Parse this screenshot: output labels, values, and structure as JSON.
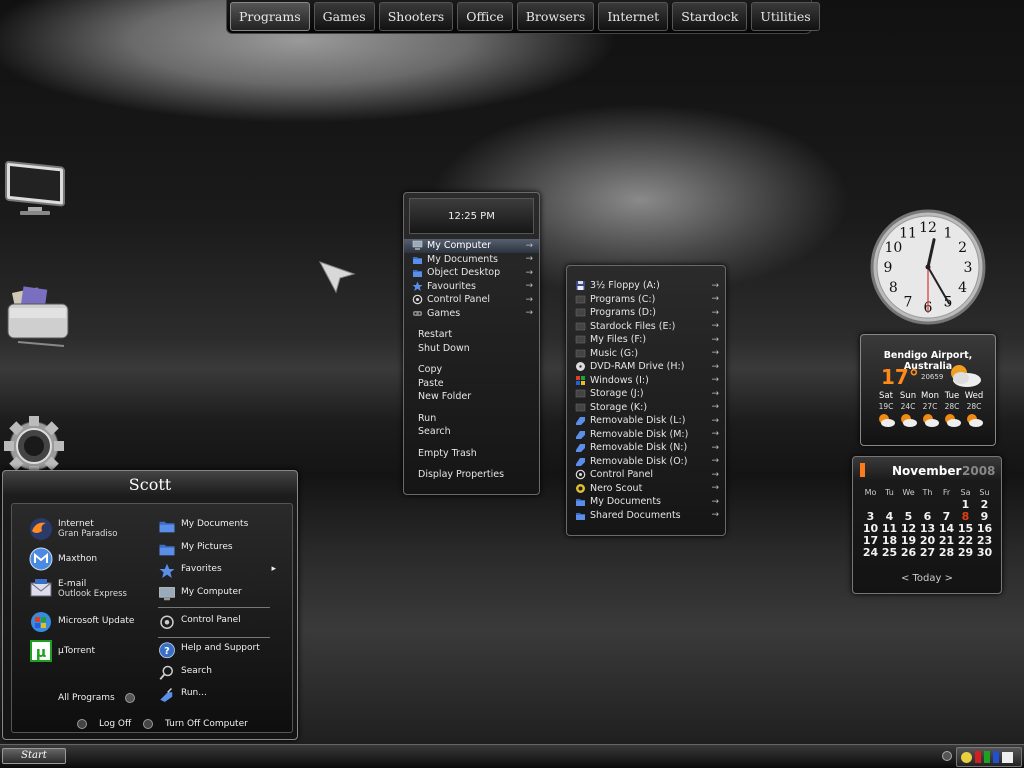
{
  "top_tabs": [
    "Programs",
    "Games",
    "Shooters",
    "Office",
    "Browsers",
    "Internet",
    "Stardock",
    "Utilities"
  ],
  "clock_menu": {
    "time": "12:25 PM",
    "items": [
      {
        "label": "My Computer",
        "icon": "computer-icon",
        "arrow": "→",
        "selected": true
      },
      {
        "label": "My Documents",
        "icon": "folder-icon",
        "arrow": "→"
      },
      {
        "label": "Object Desktop",
        "icon": "folder-icon",
        "arrow": "→"
      },
      {
        "label": "Favourites",
        "icon": "star-icon",
        "arrow": "→"
      },
      {
        "label": "Control Panel",
        "icon": "control-panel-icon",
        "arrow": "→"
      },
      {
        "label": "Games",
        "icon": "gamepad-icon",
        "arrow": "→"
      }
    ],
    "group2": [
      "Restart",
      "Shut Down"
    ],
    "group3": [
      "Copy",
      "Paste",
      "New Folder"
    ],
    "group4": [
      "Run",
      "Search"
    ],
    "group5": [
      "Empty Trash"
    ],
    "group6": [
      "Display Properties"
    ]
  },
  "computer_menu": [
    {
      "label": "3½ Floppy (A:)",
      "icon": "floppy-icon"
    },
    {
      "label": "Programs (C:)",
      "icon": "drive-icon"
    },
    {
      "label": "Programs (D:)",
      "icon": "drive-icon"
    },
    {
      "label": "Stardock Files (E:)",
      "icon": "drive-icon"
    },
    {
      "label": "My Files (F:)",
      "icon": "drive-icon"
    },
    {
      "label": "Music (G:)",
      "icon": "drive-icon"
    },
    {
      "label": "DVD-RAM Drive (H:)",
      "icon": "dvd-icon"
    },
    {
      "label": "Windows (I:)",
      "icon": "windows-drive-icon"
    },
    {
      "label": "Storage (J:)",
      "icon": "drive-icon"
    },
    {
      "label": "Storage (K:)",
      "icon": "drive-icon"
    },
    {
      "label": "Removable Disk (L:)",
      "icon": "removable-disk-icon"
    },
    {
      "label": "Removable Disk (M:)",
      "icon": "removable-disk-icon"
    },
    {
      "label": "Removable Disk (N:)",
      "icon": "removable-disk-icon"
    },
    {
      "label": "Removable Disk (O:)",
      "icon": "removable-disk-icon"
    },
    {
      "label": "Control Panel",
      "icon": "control-panel-icon"
    },
    {
      "label": "Nero Scout",
      "icon": "nero-icon"
    },
    {
      "label": "My Documents",
      "icon": "folder-icon"
    },
    {
      "label": "Shared Documents",
      "icon": "folder-icon"
    }
  ],
  "computer_menu_arrow": "→",
  "start_menu": {
    "user": "Scott",
    "left": [
      {
        "title": "Internet",
        "sub": "Gran Paradiso",
        "icon": "firefox-icon"
      },
      {
        "title": "Maxthon",
        "sub": "",
        "icon": "maxthon-icon"
      },
      {
        "title": "E-mail",
        "sub": "Outlook Express",
        "icon": "email-icon"
      },
      {
        "title": "Microsoft Update",
        "sub": "",
        "icon": "windows-update-icon"
      },
      {
        "title": "µTorrent",
        "sub": "",
        "icon": "utorrent-icon"
      }
    ],
    "right": [
      {
        "label": "My Documents",
        "icon": "folder-icon"
      },
      {
        "label": "My Pictures",
        "icon": "folder-icon"
      },
      {
        "label": "Favorites",
        "icon": "star-icon",
        "arrow": "▸"
      },
      {
        "label": "My Computer",
        "icon": "computer-icon"
      },
      {
        "label": "Control Panel",
        "icon": "control-panel-icon"
      },
      {
        "label": "Help and Support",
        "icon": "help-icon"
      },
      {
        "label": "Search",
        "icon": "search-icon"
      },
      {
        "label": "Run...",
        "icon": "run-icon"
      }
    ],
    "all_programs": "All Programs",
    "log_off": "Log Off",
    "turn_off": "Turn Off Computer"
  },
  "weather": {
    "location": "Bendigo Airport, Australia",
    "temp": "17°",
    "code": "20659",
    "days": [
      "Sat",
      "Sun",
      "Mon",
      "Tue",
      "Wed"
    ],
    "temps": [
      "19C",
      "24C",
      "27C",
      "28C",
      "28C"
    ]
  },
  "calendar": {
    "month": "November",
    "year": "2008",
    "dow": [
      "Mo",
      "Tu",
      "We",
      "Th",
      "Fr",
      "Sa",
      "Su"
    ],
    "leading_blanks": 5,
    "days": 30,
    "today": 8,
    "nav": "< Today >"
  },
  "clock": {
    "hour": 12,
    "minute": 25,
    "second": 30
  },
  "taskbar": {
    "start_label": "Start"
  },
  "colors": {
    "accent": "#ff7a1a",
    "today": "#e04010",
    "selected": "#4a5568"
  }
}
